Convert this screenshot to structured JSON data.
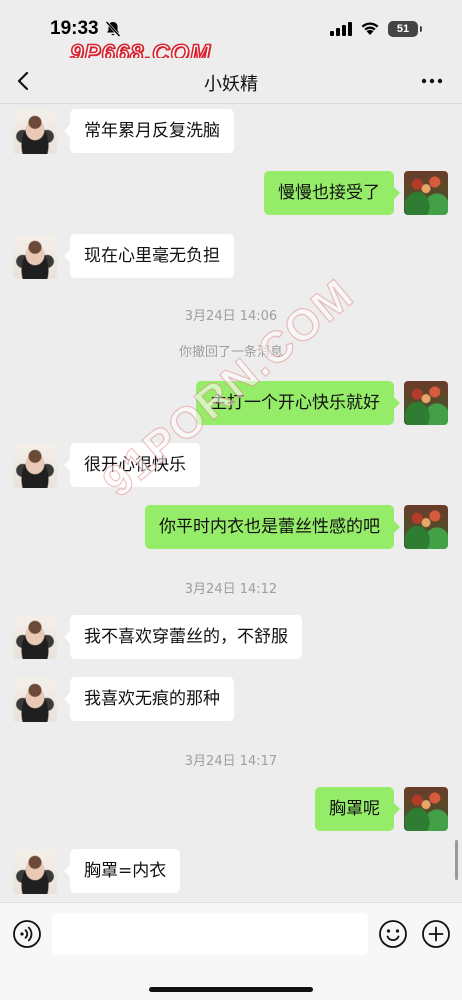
{
  "status_bar": {
    "time": "19:33",
    "battery": "51",
    "watermark": "9P668.COM",
    "icons": [
      "bell-muted-icon",
      "signal-icon",
      "wifi-icon",
      "battery-icon"
    ]
  },
  "header": {
    "title": "小妖精",
    "icons": [
      "back-icon",
      "more-icon"
    ]
  },
  "watermark_diagonal": "91PORN.COM",
  "messages": [
    {
      "type": "text",
      "side": "in",
      "text": "常年累月反复洗脑"
    },
    {
      "type": "text",
      "side": "out",
      "text": "慢慢也接受了"
    },
    {
      "type": "text",
      "side": "in",
      "text": "现在心里毫无负担"
    },
    {
      "type": "time",
      "text": "3月24日 14:06"
    },
    {
      "type": "system",
      "text": "你撤回了一条消息"
    },
    {
      "type": "text",
      "side": "out",
      "text": "主打一个开心快乐就好"
    },
    {
      "type": "text",
      "side": "in",
      "text": "很开心很快乐"
    },
    {
      "type": "text",
      "side": "out",
      "text": "你平时内衣也是蕾丝性感的吧"
    },
    {
      "type": "time",
      "text": "3月24日 14:12"
    },
    {
      "type": "text",
      "side": "in",
      "text": "我不喜欢穿蕾丝的，不舒服"
    },
    {
      "type": "text",
      "side": "in",
      "text": "我喜欢无痕的那种"
    },
    {
      "type": "time",
      "text": "3月24日 14:17"
    },
    {
      "type": "text",
      "side": "out",
      "text": "胸罩呢"
    },
    {
      "type": "text",
      "side": "in",
      "text": "胸罩=内衣"
    }
  ],
  "input_bar": {
    "placeholder": "",
    "value": "",
    "icons": [
      "voice-icon",
      "emoji-icon",
      "plus-icon"
    ]
  },
  "colors": {
    "background": "#ededed",
    "outgoing_bubble": "#95ec69",
    "incoming_bubble": "#ffffff",
    "system_text": "#9e9e9e",
    "watermark_red": "#d9232f"
  }
}
